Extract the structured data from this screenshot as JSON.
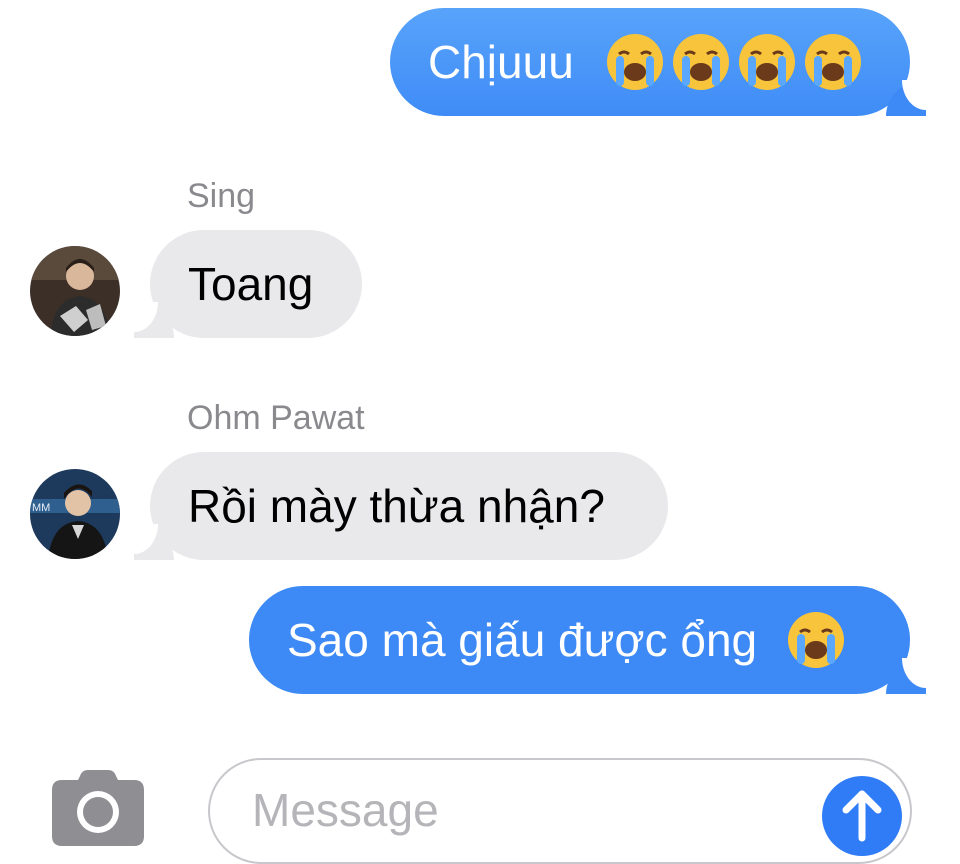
{
  "messages": [
    {
      "direction": "outgoing",
      "text": "Chịuuu",
      "emoji": [
        "loudly-crying-face-icon",
        "loudly-crying-face-icon",
        "loudly-crying-face-icon",
        "loudly-crying-face-icon"
      ]
    },
    {
      "direction": "incoming",
      "sender": "Sing",
      "text": "Toang"
    },
    {
      "direction": "incoming",
      "sender": "Ohm Pawat",
      "text": "Rồi mày thừa nhận?"
    },
    {
      "direction": "outgoing",
      "text": "Sao mà giấu được ổng",
      "emoji": [
        "loudly-crying-face-icon"
      ]
    }
  ],
  "composer": {
    "placeholder": "Message",
    "camera_icon": "camera-icon",
    "send_icon": "arrow-up-icon"
  },
  "colors": {
    "outgoing_bubble": "#3d8af7",
    "incoming_bubble": "#e9e9eb",
    "sender_name": "#8a8a8e",
    "send_button": "#2f7cf6"
  }
}
